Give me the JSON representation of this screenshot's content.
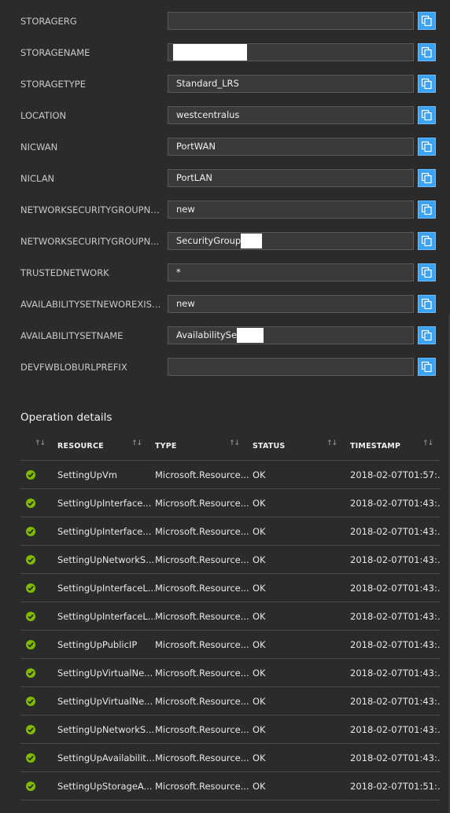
{
  "parameters": [
    {
      "label": "STORAGERG",
      "value": ""
    },
    {
      "label": "STORAGENAME",
      "value": ""
    },
    {
      "label": "STORAGETYPE",
      "value": "Standard_LRS"
    },
    {
      "label": "LOCATION",
      "value": "westcentralus"
    },
    {
      "label": "NICWAN",
      "value": "PortWAN"
    },
    {
      "label": "NICLAN",
      "value": "PortLAN"
    },
    {
      "label": "NETWORKSECURITYGROUPNE...",
      "value": "new"
    },
    {
      "label": "NETWORKSECURITYGROUPN...",
      "value": "SecurityGroup"
    },
    {
      "label": "TRUSTEDNETWORK",
      "value": "*"
    },
    {
      "label": "AVAILABILITYSETNEWOREXIST...",
      "value": "new"
    },
    {
      "label": "AVAILABILITYSETNAME",
      "value": "AvailabilitySe"
    },
    {
      "label": "DEVFWBLOBURLPREFIX",
      "value": ""
    }
  ],
  "copy_icon": "copy-icon",
  "operation_details": {
    "title": "Operation details",
    "columns": [
      "RESOURCE",
      "TYPE",
      "STATUS",
      "TIMESTAMP"
    ],
    "status_icon": "success-check-icon",
    "rows": [
      {
        "resource": "SettingUpVm",
        "type": "Microsoft.Resource...",
        "status": "OK",
        "timestamp": "2018-02-07T01:57:..."
      },
      {
        "resource": "SettingUpInterface...",
        "type": "Microsoft.Resource...",
        "status": "OK",
        "timestamp": "2018-02-07T01:43:..."
      },
      {
        "resource": "SettingUpInterface...",
        "type": "Microsoft.Resource...",
        "status": "OK",
        "timestamp": "2018-02-07T01:43:..."
      },
      {
        "resource": "SettingUpNetworkS...",
        "type": "Microsoft.Resource...",
        "status": "OK",
        "timestamp": "2018-02-07T01:43:..."
      },
      {
        "resource": "SettingUpInterfaceL...",
        "type": "Microsoft.Resource...",
        "status": "OK",
        "timestamp": "2018-02-07T01:43:..."
      },
      {
        "resource": "SettingUpInterfaceL...",
        "type": "Microsoft.Resource...",
        "status": "OK",
        "timestamp": "2018-02-07T01:43:..."
      },
      {
        "resource": "SettingUpPublicIP",
        "type": "Microsoft.Resource...",
        "status": "OK",
        "timestamp": "2018-02-07T01:43:..."
      },
      {
        "resource": "SettingUpVirtualNe...",
        "type": "Microsoft.Resource...",
        "status": "OK",
        "timestamp": "2018-02-07T01:43:..."
      },
      {
        "resource": "SettingUpVirtualNe...",
        "type": "Microsoft.Resource...",
        "status": "OK",
        "timestamp": "2018-02-07T01:43:..."
      },
      {
        "resource": "SettingUpNetworkS...",
        "type": "Microsoft.Resource...",
        "status": "OK",
        "timestamp": "2018-02-07T01:43:..."
      },
      {
        "resource": "SettingUpAvailabilit...",
        "type": "Microsoft.Resource...",
        "status": "OK",
        "timestamp": "2018-02-07T01:43:..."
      },
      {
        "resource": "SettingUpStorageA...",
        "type": "Microsoft.Resource...",
        "status": "OK",
        "timestamp": "2018-02-07T01:51:..."
      }
    ]
  },
  "colors": {
    "background": "#2b2b2b",
    "accent": "#3aa3f5",
    "success": "#7fba00"
  }
}
